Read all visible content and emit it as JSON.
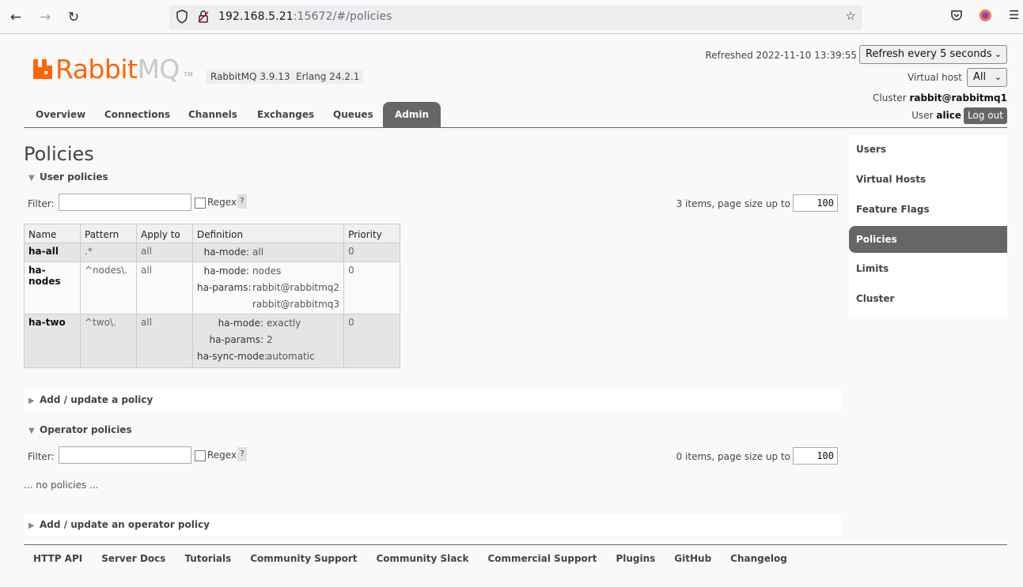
{
  "browser": {
    "url_host": "192.168.5.21",
    "url_rest": ":15672/#/policies"
  },
  "header": {
    "logo_rabbit": "Rabbit",
    "logo_mq": "MQ",
    "logo_tm": "TM",
    "rabbitmq_version": "RabbitMQ 3.9.13",
    "erlang_version": "Erlang 24.2.1",
    "refreshed": "Refreshed 2022-11-10 13:39:55",
    "refresh_select": "Refresh every 5 seconds",
    "vhost_label": "Virtual host",
    "vhost_select": "All",
    "cluster_label": "Cluster",
    "cluster_name": "rabbit@rabbitmq1",
    "user_label": "User",
    "user_name": "alice",
    "logout": "Log out"
  },
  "tabs": [
    "Overview",
    "Connections",
    "Channels",
    "Exchanges",
    "Queues",
    "Admin"
  ],
  "page_title": "Policies",
  "user_policies": {
    "heading": "User policies",
    "filter_label": "Filter:",
    "regex_label": "Regex",
    "help": "?",
    "pager_label": "3 items, page size up to",
    "page_size": "100",
    "columns": [
      "Name",
      "Pattern",
      "Apply to",
      "Definition",
      "Priority"
    ],
    "rows": [
      {
        "name": "ha-all",
        "pattern": ".*",
        "apply_to": "all",
        "definition": [
          {
            "key": "ha-mode:",
            "values": [
              "all"
            ]
          }
        ],
        "priority": "0"
      },
      {
        "name": "ha-nodes",
        "pattern": "^nodes\\.",
        "apply_to": "all",
        "definition": [
          {
            "key": "ha-mode:",
            "values": [
              "nodes"
            ]
          },
          {
            "key": "ha-params:",
            "values": [
              "rabbit@rabbitmq2",
              "rabbit@rabbitmq3"
            ]
          }
        ],
        "priority": "0"
      },
      {
        "name": "ha-two",
        "pattern": "^two\\.",
        "apply_to": "all",
        "definition": [
          {
            "key": "ha-mode:",
            "values": [
              "exactly"
            ]
          },
          {
            "key": "ha-params:",
            "values": [
              "2"
            ]
          },
          {
            "key": "ha-sync-mode:",
            "values": [
              "automatic"
            ]
          }
        ],
        "priority": "0"
      }
    ]
  },
  "add_policy": "Add / update a policy",
  "operator_policies": {
    "heading": "Operator policies",
    "filter_label": "Filter:",
    "regex_label": "Regex",
    "help": "?",
    "pager_label": "0 items, page size up to",
    "page_size": "100",
    "empty": "... no policies ..."
  },
  "add_operator_policy": "Add / update an operator policy",
  "sidebar": [
    "Users",
    "Virtual Hosts",
    "Feature Flags",
    "Policies",
    "Limits",
    "Cluster"
  ],
  "footer": [
    "HTTP API",
    "Server Docs",
    "Tutorials",
    "Community Support",
    "Community Slack",
    "Commercial Support",
    "Plugins",
    "GitHub",
    "Changelog"
  ],
  "colors": {
    "brand": "#ff6600",
    "active_tab": "#666666"
  }
}
